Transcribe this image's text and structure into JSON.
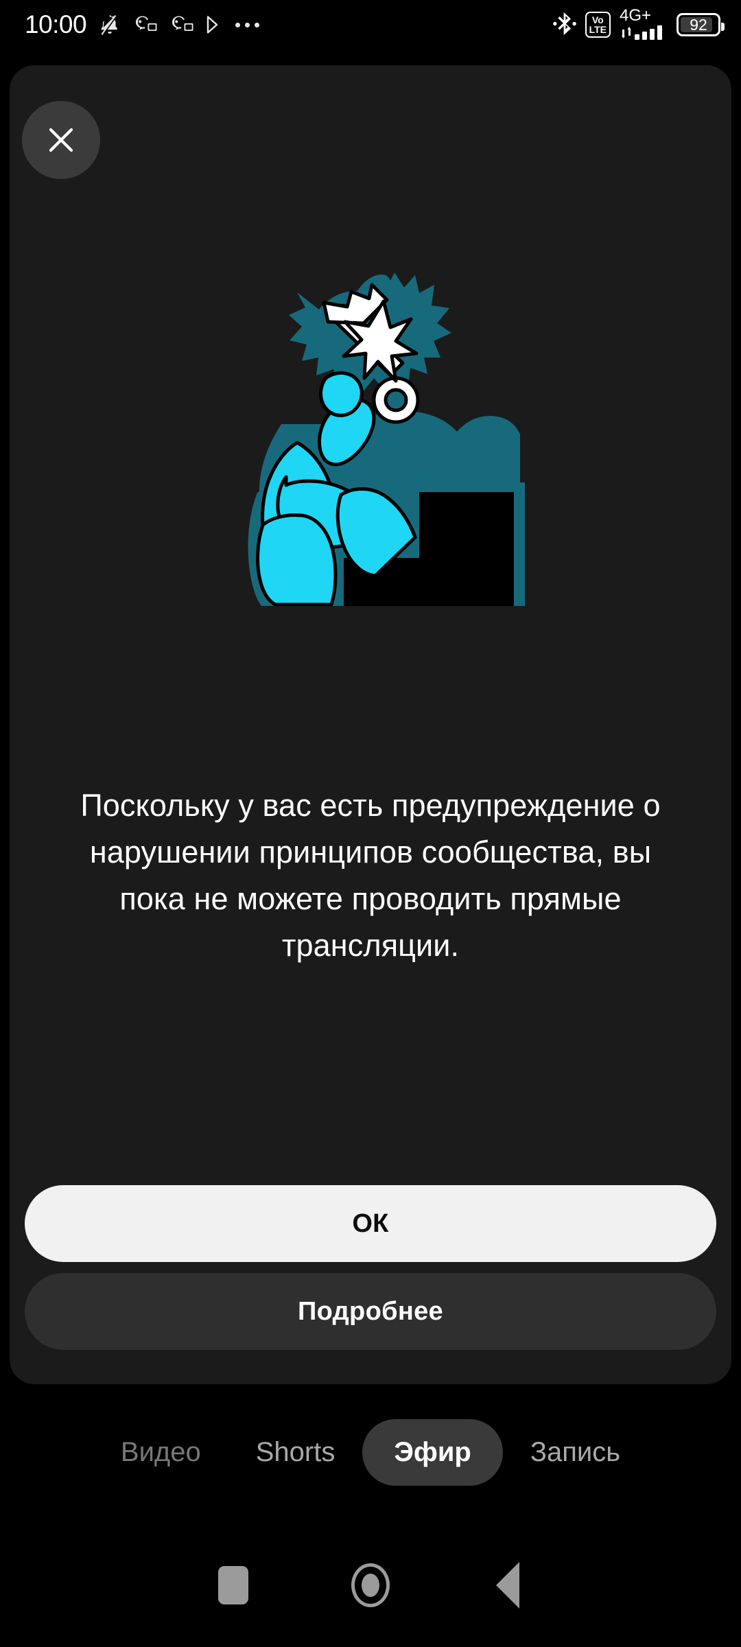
{
  "statusbar": {
    "time": "10:00",
    "left_icons": [
      "bell-muted-icon",
      "discord-icon",
      "discord-icon",
      "play-triangle-icon",
      "more-dots-icon"
    ],
    "right_icons": [
      "bluetooth-icon",
      "volte-icon",
      "signal-icon",
      "battery-icon"
    ],
    "volte_top": "Vo",
    "volte_bottom": "LTE",
    "network": "4G+",
    "battery_level": "92"
  },
  "sheet": {
    "close_label": "close-icon",
    "illustration_name": "thinking-person-with-key-illustration",
    "message": "Поскольку у вас есть предупреждение о нарушении принципов сообщества, вы пока не можете проводить прямые трансляции.",
    "buttons": {
      "primary": "ОК",
      "secondary": "Подробнее"
    }
  },
  "tabbar": {
    "tabs": [
      {
        "label": "Видео",
        "state": "dim"
      },
      {
        "label": "Shorts",
        "state": "normal"
      },
      {
        "label": "Эфир",
        "state": "active"
      },
      {
        "label": "Запись",
        "state": "normal"
      }
    ]
  },
  "navbar": {
    "recents": "recents-square-icon",
    "home": "home-circle-icon",
    "back": "back-triangle-icon"
  },
  "colors": {
    "sheet_bg": "#1b1b1b",
    "accent_cyan": "#1fd6f5",
    "accent_teal": "#176a7c",
    "primary_button": "#f1f1f1",
    "secondary_button": "#2f2f2f"
  }
}
